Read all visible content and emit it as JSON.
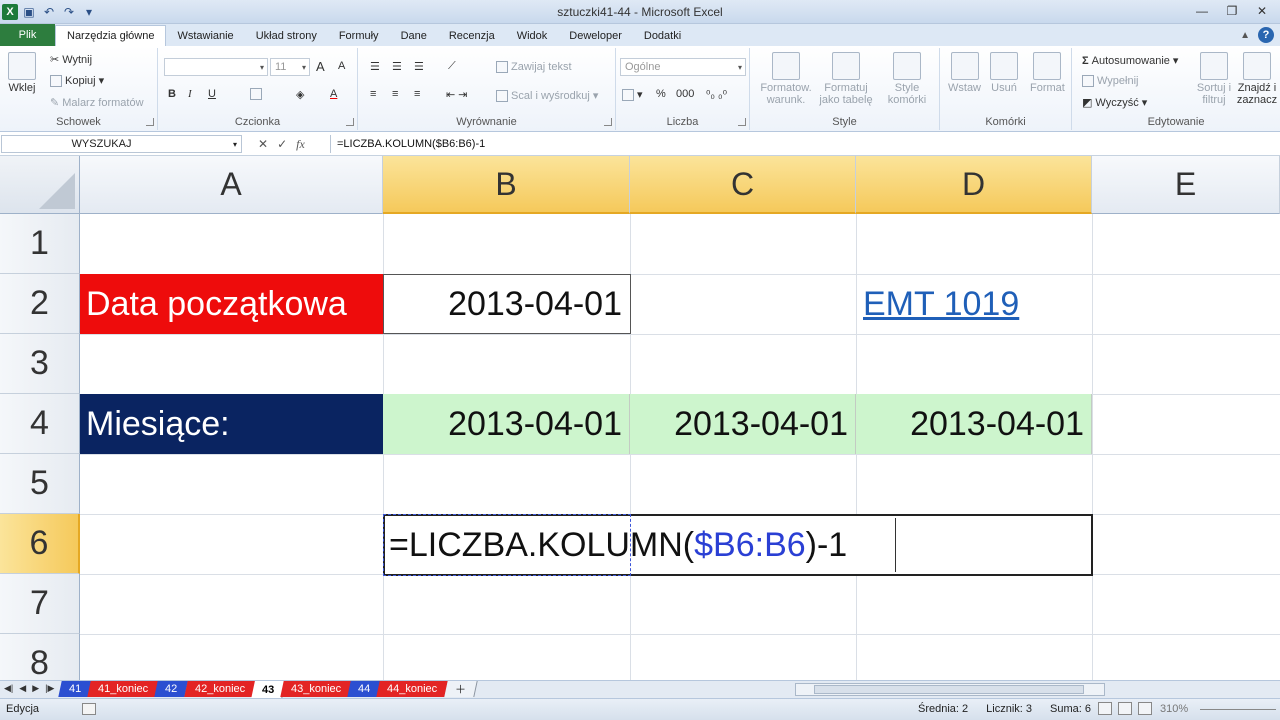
{
  "window": {
    "title": "sztuczki41-44  -  Microsoft Excel"
  },
  "ribbon_tabs": [
    "Plik",
    "Narzędzia główne",
    "Wstawianie",
    "Układ strony",
    "Formuły",
    "Dane",
    "Recenzja",
    "Widok",
    "Deweloper",
    "Dodatki"
  ],
  "ribbon": {
    "clipboard": {
      "paste": "Wklej",
      "cut": "Wytnij",
      "copy": "Kopiuj",
      "painter": "Malarz formatów",
      "label": "Schowek"
    },
    "font": {
      "size": "11",
      "bold": "B",
      "italic": "I",
      "underline": "U",
      "label": "Czcionka"
    },
    "align": {
      "wrap": "Zawijaj tekst",
      "merge": "Scal i wyśrodkuj",
      "label": "Wyrównanie"
    },
    "number": {
      "format": "Ogólne",
      "percent": "%",
      "thousands": "000",
      "label": "Liczba"
    },
    "styles": {
      "conditional": "Formatow. warunk.",
      "table": "Formatuj jako tabelę",
      "cell_styles": "Style komórki",
      "label": "Style"
    },
    "cells": {
      "insert": "Wstaw",
      "delete": "Usuń",
      "format": "Format",
      "label": "Komórki"
    },
    "editing": {
      "autosum": "Autosumowanie",
      "fill": "Wypełnij",
      "clear": "Wyczyść",
      "sort": "Sortuj i filtruj",
      "find": "Znajdź i zaznacz",
      "label": "Edytowanie"
    }
  },
  "formula_bar": {
    "name_box": "WYSZUKAJ",
    "fx": "fx",
    "formula": "=LICZBA.KOLUMN($B6:B6)-1"
  },
  "columns": [
    "A",
    "B",
    "C",
    "D",
    "E"
  ],
  "rows": [
    "1",
    "2",
    "3",
    "4",
    "5",
    "6",
    "7",
    "8"
  ],
  "cells": {
    "A2": "Data początkowa",
    "B2": "2013-04-01",
    "D2": "EMT 1019",
    "A4": "Miesiące:",
    "B4": "2013-04-01",
    "C4": "2013-04-01",
    "D4": "2013-04-01"
  },
  "editing_cell": {
    "prefix": "=LICZBA.KOLUMN(",
    "ref": "$B6:B6",
    "suffix": ")-1"
  },
  "sheet_tabs": [
    "41",
    "41_koniec",
    "42",
    "42_koniec",
    "43",
    "43_koniec",
    "44",
    "44_koniec"
  ],
  "active_sheet": "43",
  "status": {
    "mode": "Edycja",
    "avg": "Średnia: 2",
    "count": "Licznik: 3",
    "sum": "Suma: 6",
    "zoom": "310%"
  },
  "colors": {
    "red_cell": "#ee0c0c",
    "navy_cell": "#0a2461",
    "green_cell": "#cdf5cd",
    "link": "#1f5fb8",
    "header_selected": "#f5c95b"
  }
}
